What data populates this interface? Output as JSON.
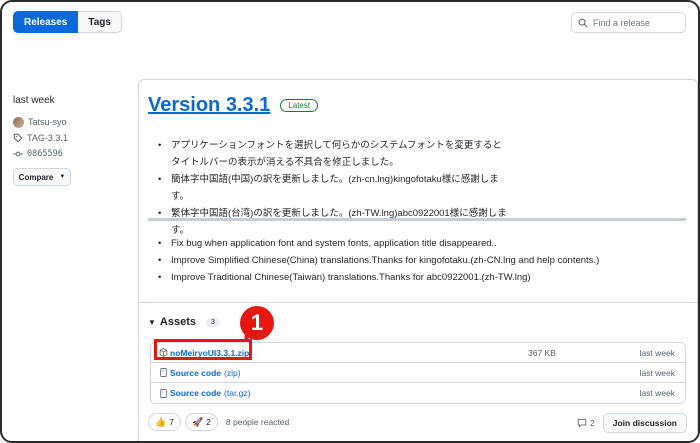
{
  "toolbar": {
    "releases_label": "Releases",
    "tags_label": "Tags",
    "search_placeholder": "Find a release"
  },
  "release_meta": {
    "date": "last week",
    "author": "Tatsu-syo",
    "tag": "TAG-3.3.1",
    "commit": "0865596",
    "compare_label": "Compare"
  },
  "release": {
    "title": "Version 3.3.1",
    "badge": "Latest",
    "notes_ja": [
      "アプリケーションフォントを選択して何らかのシステムフォントを変更するとタイトルバーの表示が消える不具合を修正しました。",
      "簡体字中国語(中国)の訳を更新しました。(zh-cn.lng)kingofotaku様に感謝します。",
      "繁体字中国語(台湾)の訳を更新しました。(zh-TW.lng)abc0922001様に感謝します。"
    ],
    "notes_en": [
      "Fix bug when application font and system fonts, application title disappeared..",
      "Improve Simplified Chinese(China) translations.Thanks for kingofotaku.(zh-CN.lng and help contents.)",
      "Improve Traditional Chinese(Taiwan) translations.Thanks for abc0922001.(zh-TW.lng)"
    ]
  },
  "assets": {
    "heading": "Assets",
    "count": "3",
    "items": [
      {
        "name": "noMeiryoUI3.3.1.zip",
        "sub": "",
        "size": "367 KB",
        "when": "last week"
      },
      {
        "name": "Source code",
        "sub": "(zip)",
        "size": "",
        "when": "last week"
      },
      {
        "name": "Source code",
        "sub": "(tar.gz)",
        "size": "",
        "when": "last week"
      }
    ]
  },
  "annotation": {
    "step": "1",
    "color": "#e5170f"
  },
  "reactions": {
    "items": [
      {
        "emoji": "👍",
        "count": "7"
      },
      {
        "emoji": "🚀",
        "count": "2"
      }
    ],
    "summary": "8 people reacted"
  },
  "discussion": {
    "comment_count": "2",
    "join_label": "Join discussion"
  },
  "colors": {
    "accent": "#0969da",
    "latest": "#1a7f37"
  }
}
